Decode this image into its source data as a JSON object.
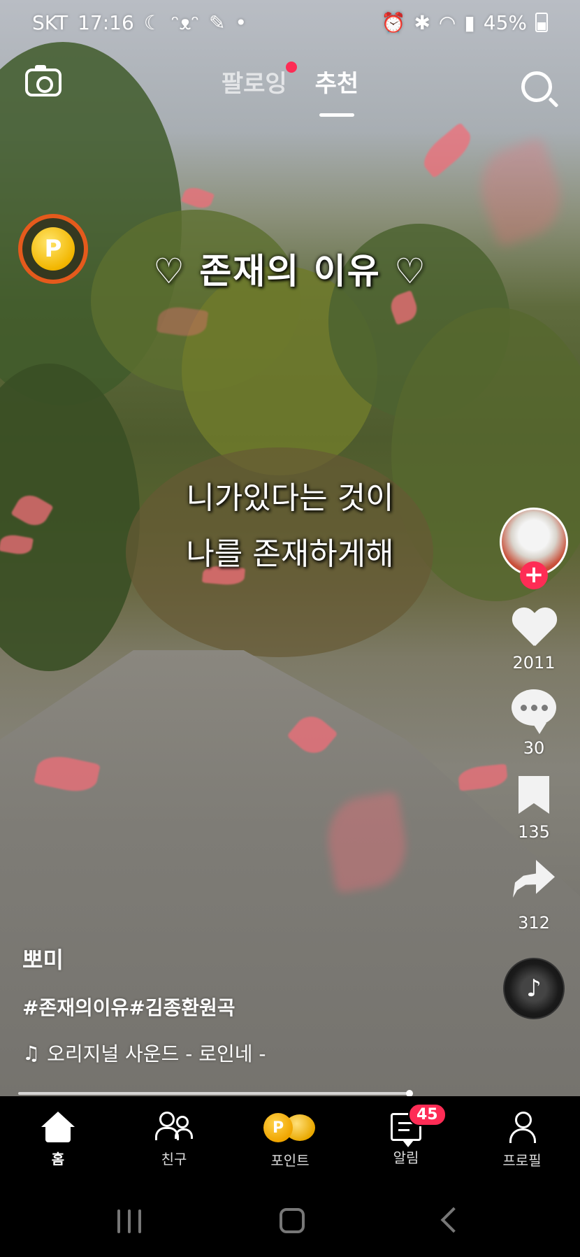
{
  "status_bar": {
    "carrier": "SKT",
    "time": "17:16",
    "dot": "•",
    "battery": "45%"
  },
  "top_nav": {
    "tabs": [
      {
        "label": "팔로잉"
      },
      {
        "label": "추천"
      }
    ]
  },
  "video": {
    "title_caption": "♡ 존재의 이유 ♡",
    "lyric_line1": "니가있다는 것이",
    "lyric_line2": "나를 존재하게해"
  },
  "actions": {
    "follow_plus": "+",
    "likes": "2011",
    "comments": "30",
    "saves": "135",
    "shares": "312"
  },
  "post": {
    "author": "뽀미",
    "hashtags": "#존재의이유#김종환원곡",
    "music_note": "♫",
    "music": "오리지널 사운드 - 로인네 -"
  },
  "bottom_tabs": [
    {
      "label": "홈"
    },
    {
      "label": "친구"
    },
    {
      "label": "포인트"
    },
    {
      "label": "알림",
      "badge": "45"
    },
    {
      "label": "프로필"
    }
  ],
  "colors": {
    "accent": "#fe2c55",
    "coin_ring": "#e55a1c",
    "coin": "#f2b600"
  }
}
